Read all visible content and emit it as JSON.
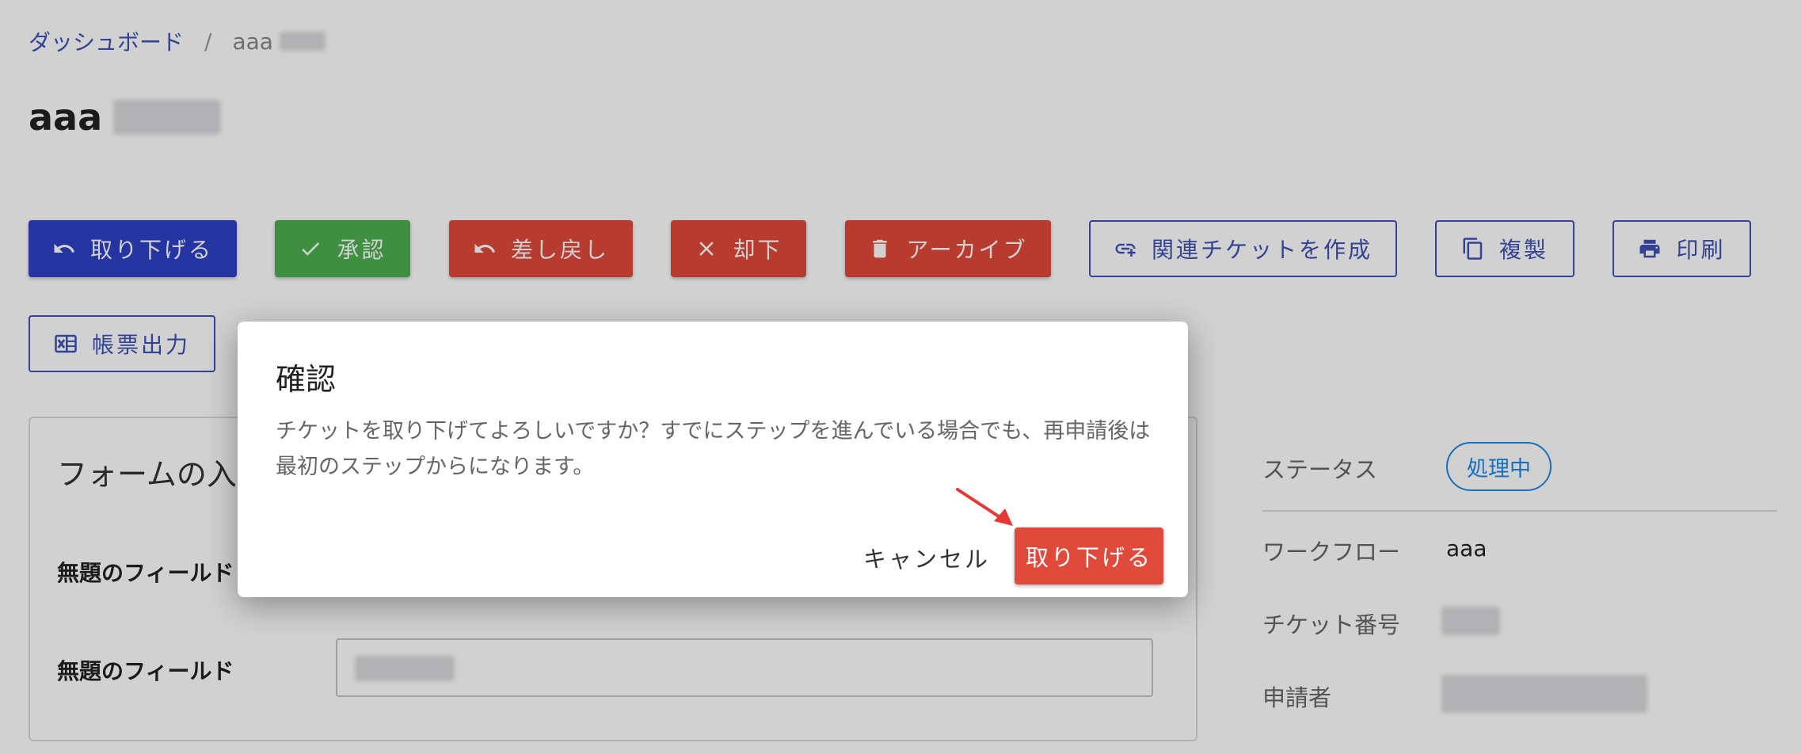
{
  "breadcrumb": {
    "home": "ダッシュボード",
    "separator": "/",
    "current": "aaa"
  },
  "page": {
    "title": "aaa"
  },
  "actions": [
    {
      "label": "取り下げる",
      "icon": "undo-icon",
      "color": "#2d40c4"
    },
    {
      "label": "承認",
      "icon": "check-icon",
      "color": "#4caf50"
    },
    {
      "label": "差し戻し",
      "icon": "undo-icon",
      "color": "#e04a3a"
    },
    {
      "label": "却下",
      "icon": "close-icon",
      "color": "#e04a3a"
    },
    {
      "label": "アーカイブ",
      "icon": "trash-icon",
      "color": "#e04a3a"
    },
    {
      "label": "関連チケットを作成",
      "icon": "link-add-icon"
    },
    {
      "label": "複製",
      "icon": "copy-icon"
    },
    {
      "label": "印刷",
      "icon": "print-icon"
    },
    {
      "label": "帳票出力",
      "icon": "excel-icon"
    }
  ],
  "form": {
    "title": "フォームの入力",
    "fields": [
      {
        "label": "無題のフィールド"
      },
      {
        "label": "無題のフィールド"
      }
    ]
  },
  "side": {
    "status_label": "ステータス",
    "status_value": "処理中",
    "workflow_label": "ワークフロー",
    "workflow_value": "aaa",
    "ticket_number_label": "チケット番号",
    "applicant_label": "申請者"
  },
  "dialog": {
    "title": "確認",
    "message": "チケットを取り下げてよろしいですか？すでにステップを進んでいる場合でも、再申請後は最初のステップからになります。",
    "cancel_label": "キャンセル",
    "confirm_label": "取り下げる"
  },
  "colors": {
    "primary": "#3f51b5",
    "danger": "#e04a3a",
    "success": "#4caf50",
    "status_chip": "#1e88e5"
  }
}
